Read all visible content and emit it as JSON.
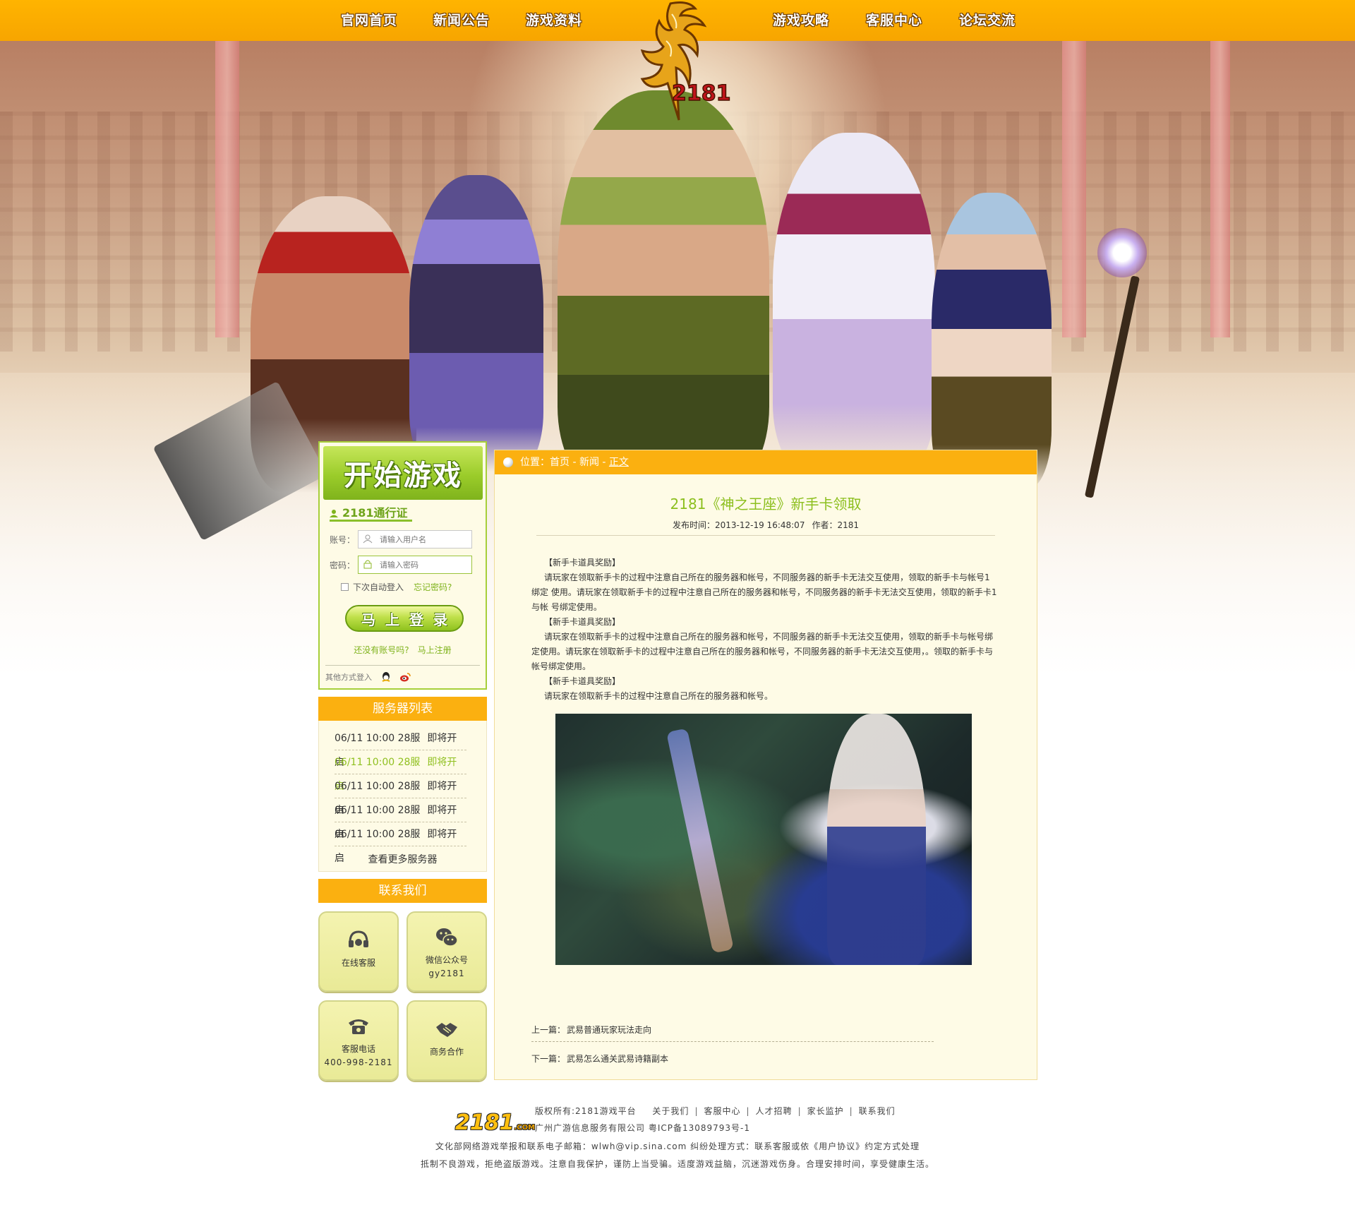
{
  "nav": {
    "items": [
      "官网首页",
      "新闻公告",
      "游戏资料",
      "游戏攻略",
      "客服中心",
      "论坛交流"
    ],
    "logo_text": "2181",
    "colors": {
      "bar": "#ffb400"
    }
  },
  "login": {
    "start_label": "开始游戏",
    "passport_label": "2181通行证",
    "account_label": "账号：",
    "account_placeholder": "请输入用户名",
    "password_label": "密码：",
    "password_placeholder": "请输入密码",
    "auto_login_label": "下次自动登入",
    "forgot_label": "忘记密码?",
    "login_button": "马上登录",
    "no_account_label": "还没有账号吗?",
    "register_label": "马上注册",
    "other_label": "其他方式登入",
    "icons": [
      "user-icon",
      "lock-icon",
      "qq-icon",
      "weibo-icon"
    ]
  },
  "servers": {
    "title": "服务器列表",
    "items": [
      {
        "time": "06/11 10:00 28服",
        "status": "即将开启"
      },
      {
        "time": "06/11 10:00 28服",
        "status": "即将开启"
      },
      {
        "time": "06/11 10:00 28服",
        "status": "即将开启"
      },
      {
        "time": "06/11 10:00 28服",
        "status": "即将开启"
      },
      {
        "time": "06/11 10:00 28服",
        "status": "即将开启"
      }
    ],
    "more_label": "查看更多服务器",
    "highlight_color": "#90c020"
  },
  "contact": {
    "title": "联系我们",
    "items": [
      {
        "label": "在线客服",
        "sub": "",
        "icon": "headset-icon"
      },
      {
        "label": "微信公众号",
        "sub": "gy2181",
        "icon": "wechat-icon"
      },
      {
        "label": "客服电话",
        "sub": "400-998-2181",
        "icon": "phone-icon"
      },
      {
        "label": "商务合作",
        "sub": "",
        "icon": "handshake-icon"
      }
    ]
  },
  "article": {
    "breadcrumb": {
      "prefix": "位置：",
      "home": "首页",
      "news": "新闻",
      "current": "正文",
      "sep": " - "
    },
    "title": "2181《神之王座》新手卡领取",
    "meta_time": "发布时间：2013-12-19 16:48:07",
    "meta_author": "作者：2181",
    "paragraphs": [
      {
        "type": "hd",
        "text": "【新手卡道具奖励】"
      },
      {
        "type": "tx",
        "text": "请玩家在领取新手卡的过程中注意自己所在的服务器和帐号，不同服务器的新手卡无法交互使用，领取的新手卡与帐号1绑定 使用。请玩家在领取新手卡的过程中注意自己所在的服务器和帐号，不同服务器的新手卡无法交互使用，领取的新手卡1与帐 号绑定使用。"
      },
      {
        "type": "hd",
        "text": "【新手卡道具奖励】"
      },
      {
        "type": "tx",
        "text": "请玩家在领取新手卡的过程中注意自己所在的服务器和帐号，不同服务器的新手卡无法交互使用，领取的新手卡与帐号绑定使用。请玩家在领取新手卡的过程中注意自己所在的服务器和帐号，不同服务器的新手卡无法交互使用，。领取的新手卡与帐号绑定使用。"
      },
      {
        "type": "hd",
        "text": "【新手卡道具奖励】"
      },
      {
        "type": "tx",
        "text": "请玩家在领取新手卡的过程中注意自己所在的服务器和帐号。"
      }
    ],
    "prev_label": "上一篇：",
    "prev_title": "武易普通玩家玩法走向",
    "next_label": "下一篇：",
    "next_title": "武易怎么通关武易诗籍副本"
  },
  "footer": {
    "logo": "2181",
    "logo_suffix": ".COM",
    "copyright": "版权所有:2181游戏平台",
    "links": [
      "关于我们",
      "客服中心",
      "人才招聘",
      "家长监护",
      "联系我们"
    ],
    "company": "广州广游信息服务有限公司 粤ICP备13089793号-1",
    "report": "文化部网络游戏举报和联系电子邮箱：wlwh@vip.sina.com 纠纷处理方式：联系客服或依《用户协议》约定方式处理",
    "notice": "抵制不良游戏，拒绝盗版游戏。注意自我保护，谨防上当受骗。适度游戏益脑，沉迷游戏伤身。合理安排时间，享受健康生活。"
  }
}
